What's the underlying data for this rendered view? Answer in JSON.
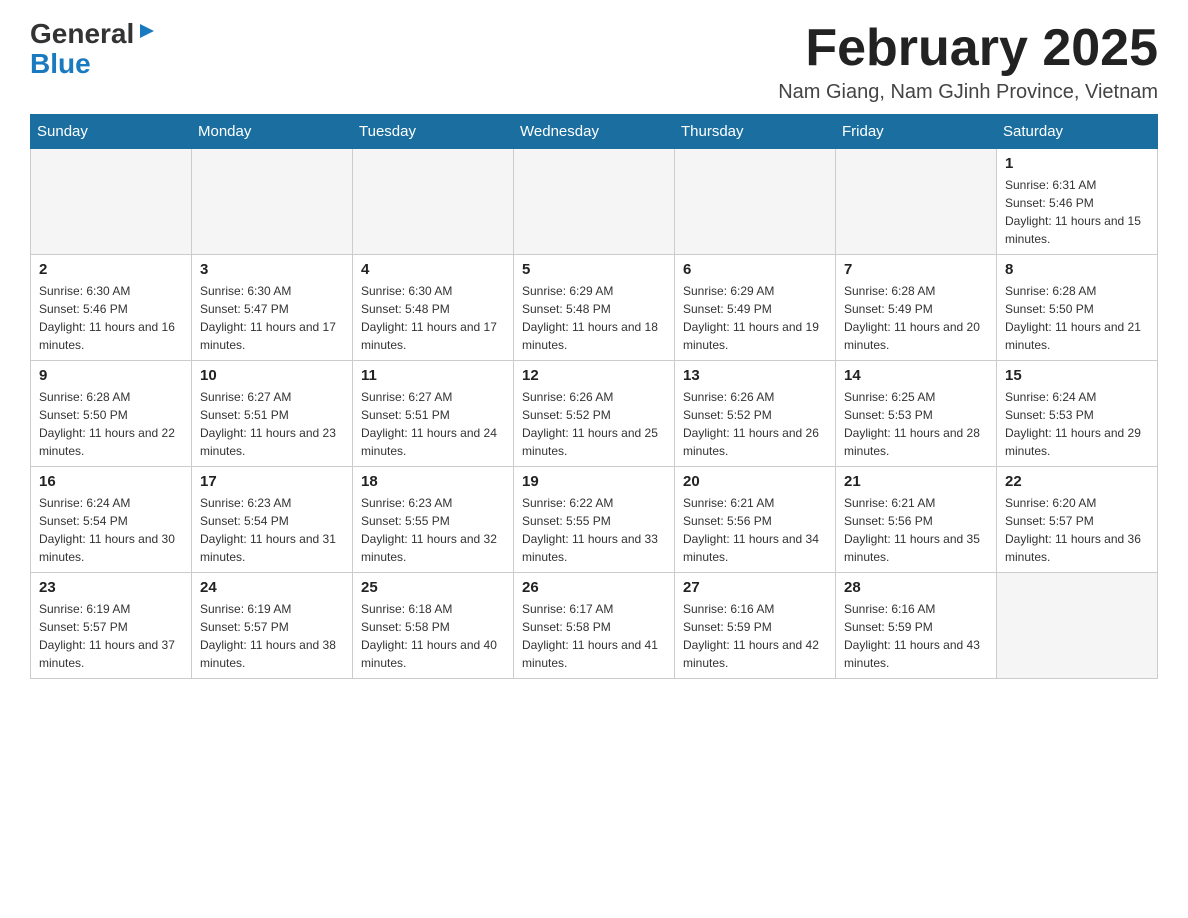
{
  "logo": {
    "line1": "General",
    "arrow": "▶",
    "line2": "Blue"
  },
  "header": {
    "title": "February 2025",
    "location": "Nam Giang, Nam GJinh Province, Vietnam"
  },
  "weekdays": [
    "Sunday",
    "Monday",
    "Tuesday",
    "Wednesday",
    "Thursday",
    "Friday",
    "Saturday"
  ],
  "weeks": [
    [
      {
        "day": "",
        "info": ""
      },
      {
        "day": "",
        "info": ""
      },
      {
        "day": "",
        "info": ""
      },
      {
        "day": "",
        "info": ""
      },
      {
        "day": "",
        "info": ""
      },
      {
        "day": "",
        "info": ""
      },
      {
        "day": "1",
        "info": "Sunrise: 6:31 AM\nSunset: 5:46 PM\nDaylight: 11 hours and 15 minutes."
      }
    ],
    [
      {
        "day": "2",
        "info": "Sunrise: 6:30 AM\nSunset: 5:46 PM\nDaylight: 11 hours and 16 minutes."
      },
      {
        "day": "3",
        "info": "Sunrise: 6:30 AM\nSunset: 5:47 PM\nDaylight: 11 hours and 17 minutes."
      },
      {
        "day": "4",
        "info": "Sunrise: 6:30 AM\nSunset: 5:48 PM\nDaylight: 11 hours and 17 minutes."
      },
      {
        "day": "5",
        "info": "Sunrise: 6:29 AM\nSunset: 5:48 PM\nDaylight: 11 hours and 18 minutes."
      },
      {
        "day": "6",
        "info": "Sunrise: 6:29 AM\nSunset: 5:49 PM\nDaylight: 11 hours and 19 minutes."
      },
      {
        "day": "7",
        "info": "Sunrise: 6:28 AM\nSunset: 5:49 PM\nDaylight: 11 hours and 20 minutes."
      },
      {
        "day": "8",
        "info": "Sunrise: 6:28 AM\nSunset: 5:50 PM\nDaylight: 11 hours and 21 minutes."
      }
    ],
    [
      {
        "day": "9",
        "info": "Sunrise: 6:28 AM\nSunset: 5:50 PM\nDaylight: 11 hours and 22 minutes."
      },
      {
        "day": "10",
        "info": "Sunrise: 6:27 AM\nSunset: 5:51 PM\nDaylight: 11 hours and 23 minutes."
      },
      {
        "day": "11",
        "info": "Sunrise: 6:27 AM\nSunset: 5:51 PM\nDaylight: 11 hours and 24 minutes."
      },
      {
        "day": "12",
        "info": "Sunrise: 6:26 AM\nSunset: 5:52 PM\nDaylight: 11 hours and 25 minutes."
      },
      {
        "day": "13",
        "info": "Sunrise: 6:26 AM\nSunset: 5:52 PM\nDaylight: 11 hours and 26 minutes."
      },
      {
        "day": "14",
        "info": "Sunrise: 6:25 AM\nSunset: 5:53 PM\nDaylight: 11 hours and 28 minutes."
      },
      {
        "day": "15",
        "info": "Sunrise: 6:24 AM\nSunset: 5:53 PM\nDaylight: 11 hours and 29 minutes."
      }
    ],
    [
      {
        "day": "16",
        "info": "Sunrise: 6:24 AM\nSunset: 5:54 PM\nDaylight: 11 hours and 30 minutes."
      },
      {
        "day": "17",
        "info": "Sunrise: 6:23 AM\nSunset: 5:54 PM\nDaylight: 11 hours and 31 minutes."
      },
      {
        "day": "18",
        "info": "Sunrise: 6:23 AM\nSunset: 5:55 PM\nDaylight: 11 hours and 32 minutes."
      },
      {
        "day": "19",
        "info": "Sunrise: 6:22 AM\nSunset: 5:55 PM\nDaylight: 11 hours and 33 minutes."
      },
      {
        "day": "20",
        "info": "Sunrise: 6:21 AM\nSunset: 5:56 PM\nDaylight: 11 hours and 34 minutes."
      },
      {
        "day": "21",
        "info": "Sunrise: 6:21 AM\nSunset: 5:56 PM\nDaylight: 11 hours and 35 minutes."
      },
      {
        "day": "22",
        "info": "Sunrise: 6:20 AM\nSunset: 5:57 PM\nDaylight: 11 hours and 36 minutes."
      }
    ],
    [
      {
        "day": "23",
        "info": "Sunrise: 6:19 AM\nSunset: 5:57 PM\nDaylight: 11 hours and 37 minutes."
      },
      {
        "day": "24",
        "info": "Sunrise: 6:19 AM\nSunset: 5:57 PM\nDaylight: 11 hours and 38 minutes."
      },
      {
        "day": "25",
        "info": "Sunrise: 6:18 AM\nSunset: 5:58 PM\nDaylight: 11 hours and 40 minutes."
      },
      {
        "day": "26",
        "info": "Sunrise: 6:17 AM\nSunset: 5:58 PM\nDaylight: 11 hours and 41 minutes."
      },
      {
        "day": "27",
        "info": "Sunrise: 6:16 AM\nSunset: 5:59 PM\nDaylight: 11 hours and 42 minutes."
      },
      {
        "day": "28",
        "info": "Sunrise: 6:16 AM\nSunset: 5:59 PM\nDaylight: 11 hours and 43 minutes."
      },
      {
        "day": "",
        "info": ""
      }
    ]
  ]
}
